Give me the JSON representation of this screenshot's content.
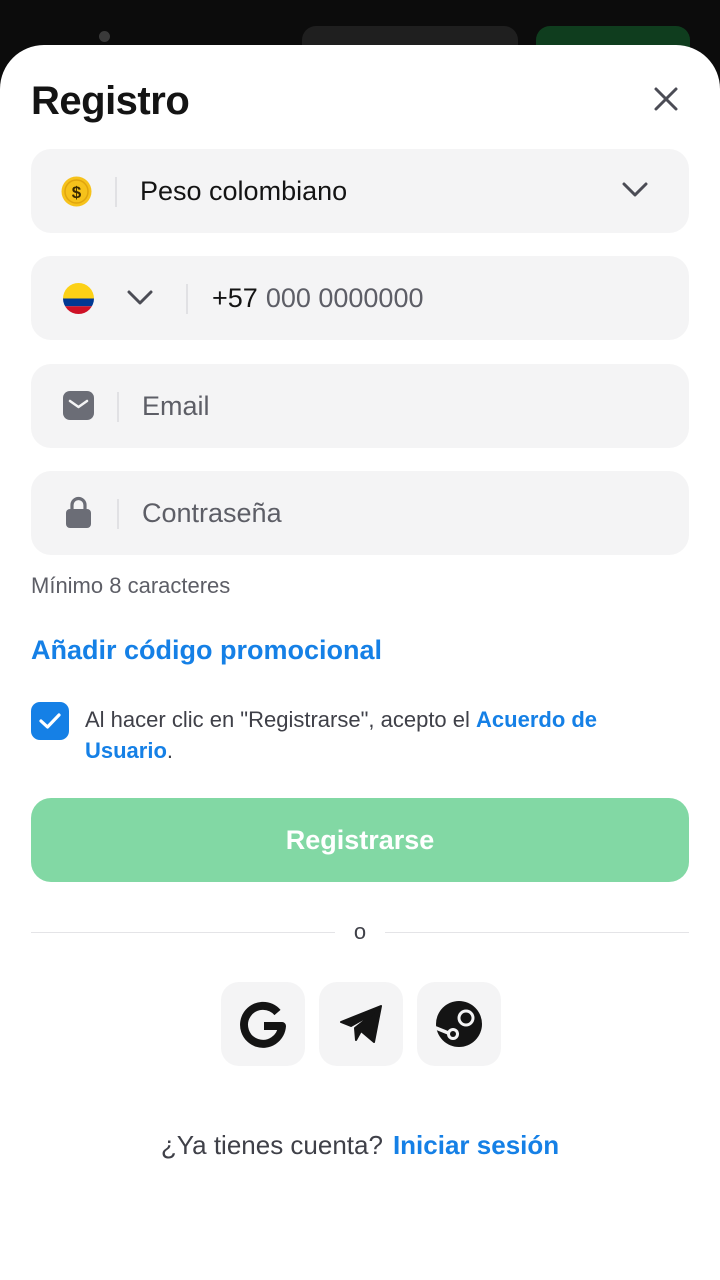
{
  "title": "Registro",
  "currency": {
    "icon": "dollar-coin-icon",
    "value": "Peso colombiano"
  },
  "phone": {
    "flag": "colombia-flag-icon",
    "prefix": "+57",
    "placeholder": "000 0000000"
  },
  "email": {
    "placeholder": "Email"
  },
  "password": {
    "placeholder": "Contraseña",
    "hint": "Mínimo 8 caracteres"
  },
  "promo_label": "Añadir código promocional",
  "terms": {
    "checked": true,
    "text": "Al hacer clic en \"Registrarse\", acepto el ",
    "link": "Acuerdo de Usuario",
    "end": "."
  },
  "register_label": "Registrarse",
  "divider_text": "o",
  "social": [
    "google-icon",
    "telegram-icon",
    "steam-icon"
  ],
  "login": {
    "question": "¿Ya tienes cuenta?",
    "link": "Iniciar sesión"
  },
  "colors": {
    "accent": "#1580e6",
    "button": "#82d8a4",
    "field_bg": "#f4f4f5"
  }
}
